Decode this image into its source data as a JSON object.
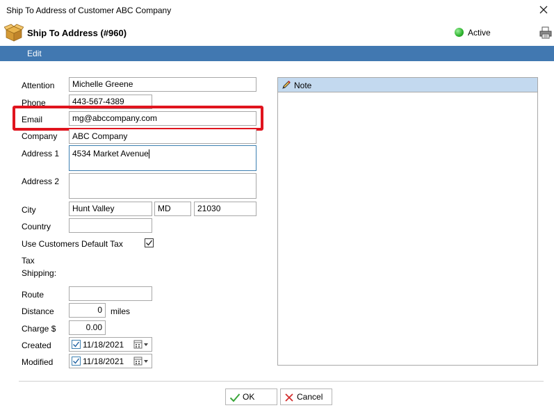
{
  "window": {
    "title": "Ship To Address of Customer ABC Company"
  },
  "header": {
    "title": "Ship To Address (#960)",
    "status": "Active",
    "status_color": "#2db22d"
  },
  "menu": {
    "edit_label": "Edit"
  },
  "form": {
    "attention": {
      "label": "Attention",
      "value": "Michelle Greene"
    },
    "phone": {
      "label": "Phone",
      "value": "443-567-4389"
    },
    "email": {
      "label": "Email",
      "value": "mg@abccompany.com"
    },
    "company": {
      "label": "Company",
      "value": "ABC Company"
    },
    "address1": {
      "label": "Address 1",
      "value": "4534 Market Avenue"
    },
    "address2": {
      "label": "Address 2",
      "value": ""
    },
    "city": {
      "label": "City",
      "value": "Hunt Valley",
      "state": "MD",
      "zip": "21030"
    },
    "country": {
      "label": "Country",
      "value": ""
    },
    "default_tax": {
      "label": "Use Customers Default Tax",
      "checked": true
    },
    "tax": {
      "label": "Tax"
    },
    "shipping": {
      "label": "Shipping:"
    },
    "route": {
      "label": "Route",
      "value": ""
    },
    "distance": {
      "label": "Distance",
      "value": "0",
      "unit": "miles"
    },
    "charge": {
      "label": "Charge $",
      "value": "0.00"
    },
    "created": {
      "label": "Created",
      "value": "11/18/2021",
      "checked": true
    },
    "modified": {
      "label": "Modified",
      "value": "11/18/2021",
      "checked": true
    }
  },
  "note": {
    "label": "Note"
  },
  "buttons": {
    "ok": "OK",
    "cancel": "Cancel"
  },
  "colors": {
    "highlight": "#e0141e",
    "menubar": "#4178b1",
    "note_header": "#c3d9ef"
  }
}
